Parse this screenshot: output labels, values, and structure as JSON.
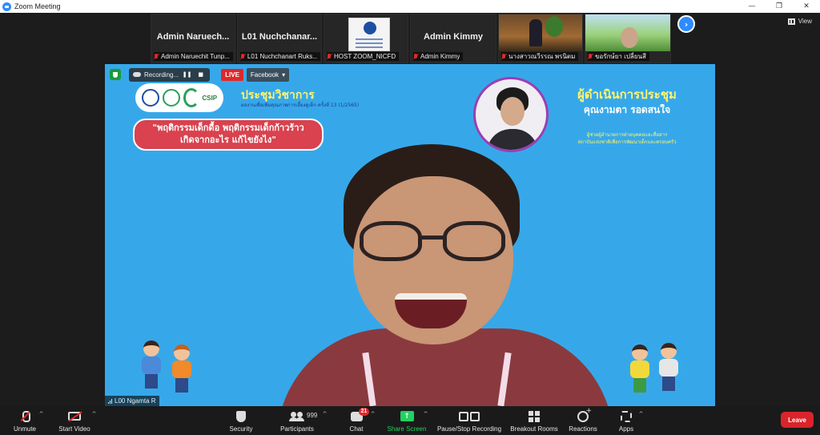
{
  "window": {
    "title": "Zoom Meeting",
    "controls": {
      "minimize": "—",
      "maximize": "❐",
      "close": "✕"
    }
  },
  "thumbnails": [
    {
      "big_name": "Admin Naruech...",
      "label": "Admin Naruechit Tunp..."
    },
    {
      "big_name": "L01 Nuchchanar...",
      "label": "L01 Nuchchanart Ruks..."
    },
    {
      "big_name": "",
      "label": "HOST ZOOM_NICFD"
    },
    {
      "big_name": "Admin Kimmy",
      "label": "Admin Kimmy"
    },
    {
      "big_name": "",
      "label": "นางสาวณวีรรณ พรนิตม"
    },
    {
      "big_name": "",
      "label": "ขอรักษ์ยา เปลี่ยนสี"
    }
  ],
  "view_button": {
    "label": "View"
  },
  "next_page": {
    "icon": "chevron-right-icon"
  },
  "recording": {
    "status": "Recording...",
    "pause": "❚❚",
    "stop": "■"
  },
  "live": {
    "badge": "LIVE",
    "destination": "Facebook",
    "caret": "▾"
  },
  "slide": {
    "logos": {
      "csip": "CSIP"
    },
    "conference_title": "ประชุมวิชาการ",
    "conference_subtitle": "ผลงานเพื่อเพิ่มคุณภาพการเลี้ยงดูเด็ก ครั้งที่ 13 (1/2565)",
    "topic_line1": "\"พฤติกรรมเด็กดื้อ พฤติกรรมเด็กก้าวร้าว",
    "topic_line2": "เกิดจากอะไร แก้ไขยังไง\"",
    "moderator_title": "ผู้ดำเนินการประชุม",
    "moderator_name": "คุณงามตา รอดสนใจ",
    "moderator_role_line1": "ผู้ช่วยผู้อำนวยการฝ่ายบุคคลและสื่อสาร",
    "moderator_role_line2": "สถาบันแห่งชาติเพื่อการพัฒนาเด็กและครอบครัว"
  },
  "speaker": {
    "name": "L00 Ngamta R"
  },
  "toolbar": {
    "unmute": "Unmute",
    "start_video": "Start Video",
    "security": "Security",
    "participants": "Participants",
    "participants_count": "999",
    "chat": "Chat",
    "chat_badge": "21",
    "share_screen": "Share Screen",
    "pause_stop_recording": "Pause/Stop Recording",
    "breakout_rooms": "Breakout Rooms",
    "reactions": "Reactions",
    "apps": "Apps",
    "leave": "Leave",
    "caret": "^",
    "share_arrow": "↑"
  },
  "colors": {
    "slide_bg": "#36a8ea",
    "accent_yellow": "#fff46a",
    "zoom_blue": "#2d8cff",
    "share_green": "#23d160",
    "leave_red": "#d9242b",
    "muted_red": "#e02828"
  }
}
